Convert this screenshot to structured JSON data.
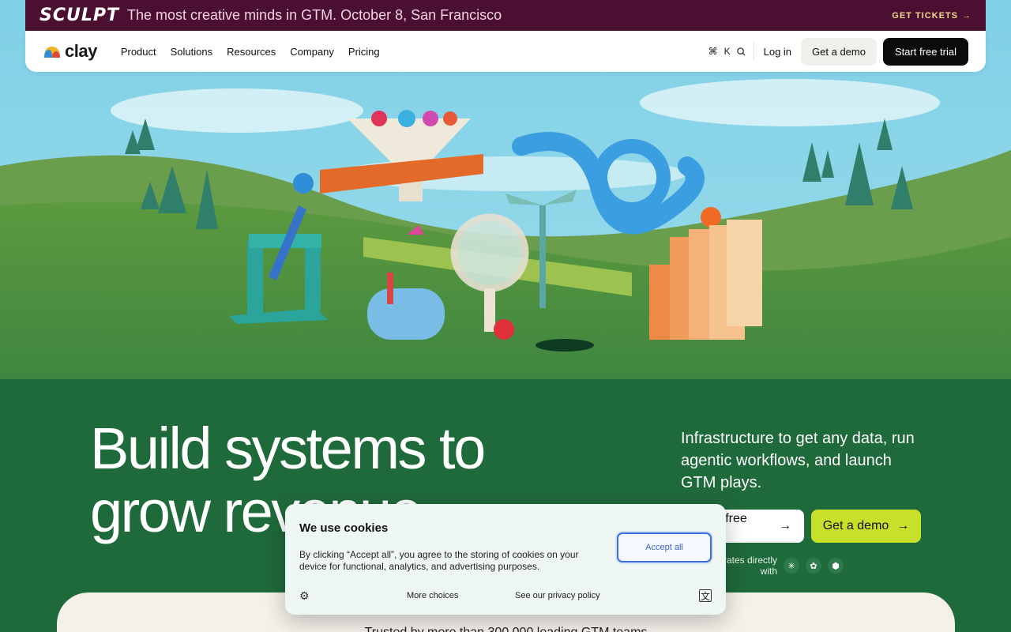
{
  "announcement": {
    "logo": "SCULPT",
    "message": "The most creative minds in GTM. October 8, San Francisco",
    "cta_label": "GET TICKETS",
    "cta_icon": "arrow-right-icon"
  },
  "nav": {
    "brand": "clay",
    "menu": [
      "Product",
      "Solutions",
      "Resources",
      "Company",
      "Pricing"
    ],
    "shortcut_cmd": "⌘",
    "shortcut_key": "K",
    "login_label": "Log in",
    "demo_label": "Get a demo",
    "trial_label": "Start free trial"
  },
  "hero": {
    "headline_line1": "Build systems to",
    "headline_line2": "grow revenue",
    "subcopy": "Infrastructure to get any data, run agentic workflows, and launch GTM plays.",
    "cta_trial_label": "Start free trial",
    "cta_demo_label": "Get a demo",
    "integrates_label": "Integrates directly with",
    "integration_icons": [
      "anthropic-icon",
      "openai-icon",
      "cube-icon"
    ]
  },
  "trusted": {
    "text": "Trusted by more than 300,000 leading GTM teams"
  },
  "cookie": {
    "title": "We use cookies",
    "body": "By clicking “Accept all”, you agree to the storing of cookies on your device for functional, analytics, and advertising purposes.",
    "accept_label": "Accept all",
    "more_label": "More choices",
    "policy_label": "See our privacy policy"
  },
  "colors": {
    "announce_bg": "#4b0f32",
    "accent_lime": "#c8e02a",
    "hero_green": "#1f6a3a"
  }
}
